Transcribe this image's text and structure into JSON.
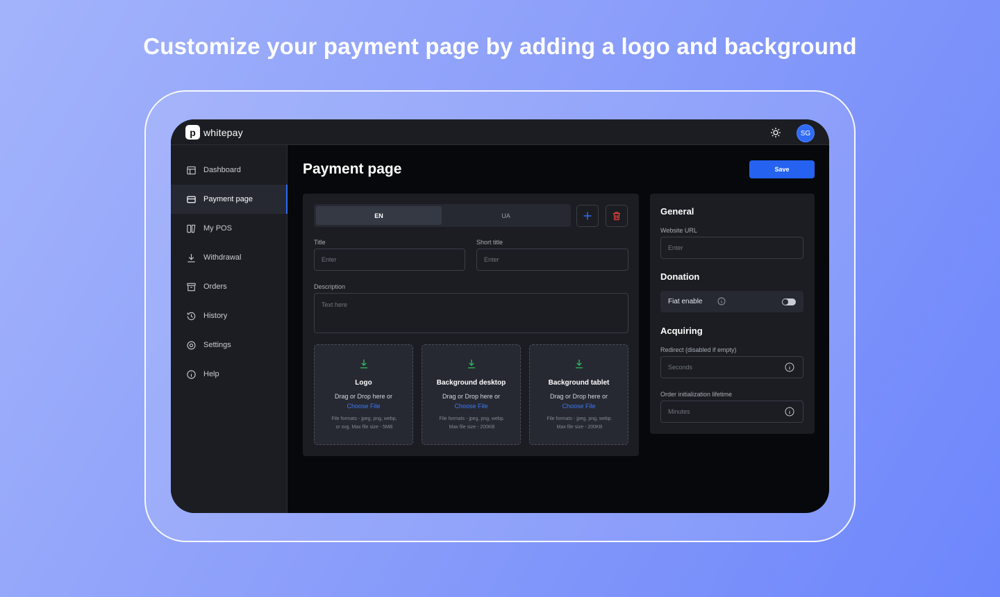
{
  "headline": "Customize your payment page by adding a logo and background",
  "app": {
    "logo_text": "whitepay",
    "logo_mark": "p",
    "avatar_initials": "SG",
    "theme_icon": "sun-icon"
  },
  "sidebar": {
    "items": [
      {
        "label": "Dashboard",
        "icon": "dashboard-icon",
        "active": false
      },
      {
        "label": "Payment page",
        "icon": "card-icon",
        "active": true
      },
      {
        "label": "My POS",
        "icon": "pos-icon",
        "active": false
      },
      {
        "label": "Withdrawal",
        "icon": "download-icon",
        "active": false
      },
      {
        "label": "Orders",
        "icon": "archive-icon",
        "active": false
      },
      {
        "label": "History",
        "icon": "history-icon",
        "active": false
      },
      {
        "label": "Settings",
        "icon": "gear-icon",
        "active": false
      },
      {
        "label": "Help",
        "icon": "info-icon",
        "active": false
      }
    ]
  },
  "main": {
    "title": "Payment page",
    "save_label": "Save",
    "tabs": [
      {
        "label": "EN",
        "active": true
      },
      {
        "label": "UA",
        "active": false
      }
    ],
    "form": {
      "title_label": "Title",
      "title_placeholder": "Enter",
      "short_title_label": "Short title",
      "short_title_placeholder": "Enter",
      "description_label": "Description",
      "description_placeholder": "Text here"
    },
    "uploads": [
      {
        "title": "Logo",
        "drag": "Drag or Drop here or",
        "choose": "Choose File",
        "info_1": "File formats - jpeg, png, webp,",
        "info_2": "or svg. Max file size - 5MB"
      },
      {
        "title": "Background desktop",
        "drag": "Drag or Drop here or",
        "choose": "Choose File",
        "info_1": "File formats - jpeg, png, webp.",
        "info_2": "Max file size - 200KB"
      },
      {
        "title": "Background tablet",
        "drag": "Drag or Drop here or",
        "choose": "Choose File",
        "info_1": "File formats - jpeg, png, webp.",
        "info_2": "Max file size - 200KB"
      }
    ]
  },
  "settings": {
    "general_title": "General",
    "website_url_label": "Website URL",
    "website_url_placeholder": "Enter",
    "donation_title": "Donation",
    "fiat_enable_label": "Fiat enable",
    "fiat_enabled": false,
    "acquiring_title": "Acquiring",
    "redirect_label": "Redirect (disabled if empty)",
    "redirect_placeholder": "Seconds",
    "lifetime_label": "Order initialization lifetime",
    "lifetime_placeholder": "Minutes"
  },
  "colors": {
    "accent": "#2562f0",
    "link": "#3e78f5",
    "upload_icon": "#2fb45a",
    "delete_icon": "#e8413f"
  }
}
